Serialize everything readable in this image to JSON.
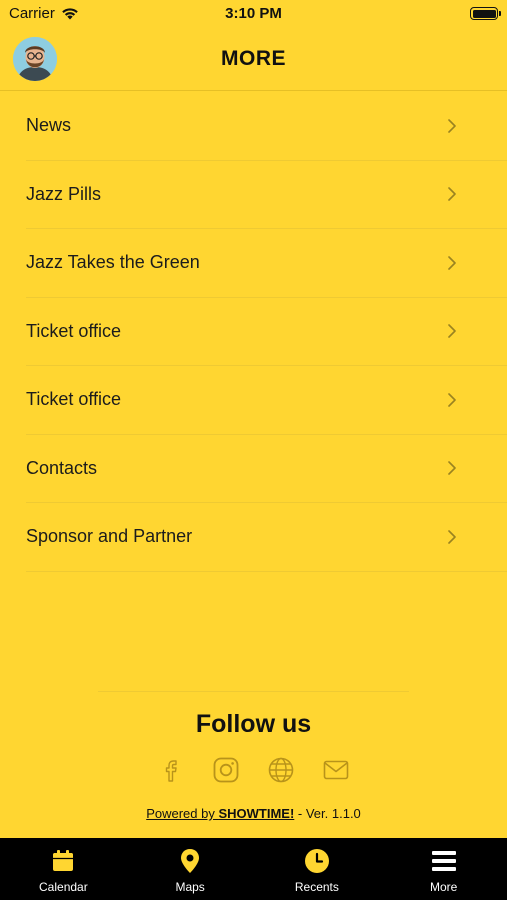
{
  "status_bar": {
    "carrier": "Carrier",
    "time": "3:10 PM"
  },
  "header": {
    "title": "MORE"
  },
  "menu": {
    "items": [
      {
        "label": "News"
      },
      {
        "label": "Jazz Pills"
      },
      {
        "label": "Jazz Takes the Green"
      },
      {
        "label": "Ticket office"
      },
      {
        "label": "Ticket office"
      },
      {
        "label": "Contacts"
      },
      {
        "label": "Sponsor and Partner"
      }
    ]
  },
  "footer": {
    "follow_title": "Follow us",
    "socials": [
      "facebook-icon",
      "instagram-icon",
      "globe-icon",
      "mail-icon"
    ],
    "powered_prefix": "Powered by ",
    "powered_brand": "SHOWTIME!",
    "version": " - Ver. 1.1.0"
  },
  "tab_bar": {
    "tabs": [
      {
        "label": "Calendar",
        "icon": "calendar-icon"
      },
      {
        "label": "Maps",
        "icon": "map-pin-icon"
      },
      {
        "label": "Recents",
        "icon": "clock-icon"
      },
      {
        "label": "More",
        "icon": "menu-icon"
      }
    ]
  },
  "colors": {
    "background": "#FFD631",
    "accent": "#FFD631",
    "tab_bar": "#000000",
    "text": "#1b1b1b"
  }
}
